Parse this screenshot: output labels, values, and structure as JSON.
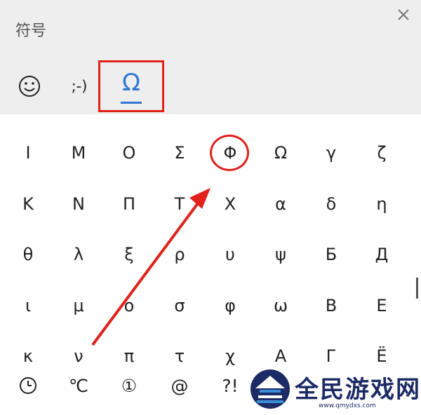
{
  "panel": {
    "title": "符号"
  },
  "tabs": {
    "emoji": {
      "icon": "smiley-face-icon"
    },
    "emoticon": {
      "label": ";-)"
    },
    "symbols": {
      "label": "Ω",
      "selected": true
    }
  },
  "symbols": [
    "Ι",
    "Μ",
    "Ο",
    "Σ",
    "Φ",
    "Ω",
    "γ",
    "ζ",
    "Κ",
    "Ν",
    "Π",
    "Τ",
    "Χ",
    "α",
    "δ",
    "η",
    "θ",
    "λ",
    "ξ",
    "ρ",
    "υ",
    "ψ",
    "Б",
    "Д",
    "ι",
    "μ",
    "ο",
    "σ",
    "φ",
    "ω",
    "В",
    "Е",
    "κ",
    "ν",
    "π",
    "τ",
    "χ",
    "А",
    "Г",
    "Ё"
  ],
  "categories": [
    {
      "icon": "clock-icon"
    },
    {
      "label": "℃"
    },
    {
      "label": "①"
    },
    {
      "label": "@"
    },
    {
      "label": "?!"
    }
  ],
  "watermark": {
    "text": "全民游戏网",
    "url": "www.qmydxs.com"
  },
  "annotation_color": "#e0221b",
  "accent_color": "#2f78d4"
}
